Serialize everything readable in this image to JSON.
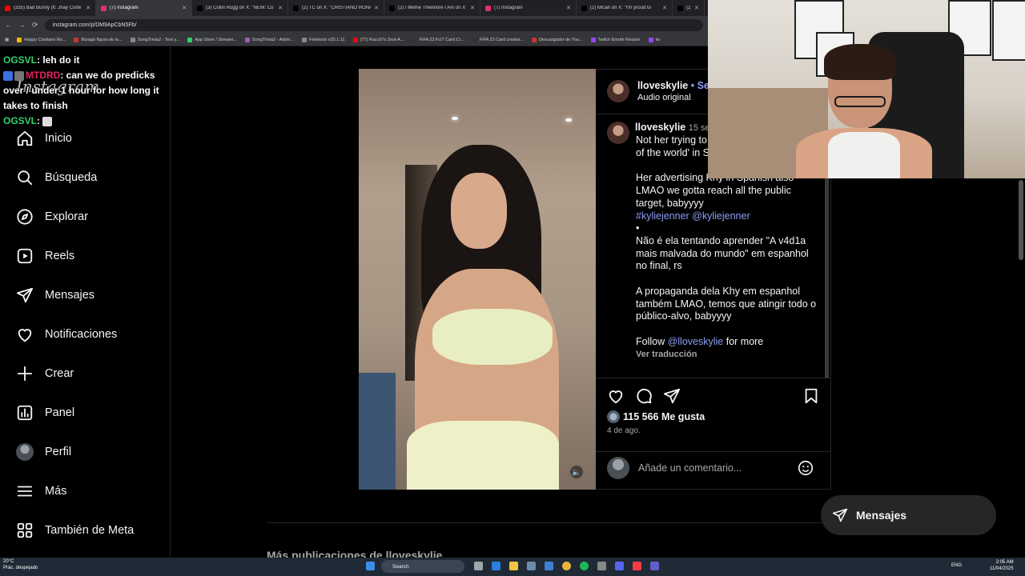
{
  "browser": {
    "tabs": [
      {
        "label": "(335) Bad Bunny (ft. Jhay Corte",
        "color": "#ff0000"
      },
      {
        "label": "(7) Instagram",
        "color": "#e1306c",
        "active": true
      },
      {
        "label": "(3) Collin Rugg on X: \"NEW: Co",
        "color": "#000000"
      },
      {
        "label": "(2) TC on X: \"CRISTIANO RONA",
        "color": "#000000"
      },
      {
        "label": "(2) I Meme Therefore I Am on X",
        "color": "#000000"
      },
      {
        "label": "(7) Instagram",
        "color": "#e1306c"
      },
      {
        "label": "(2) Micah on X: \"I'm proud to",
        "color": "#000000"
      },
      {
        "label": "(2) vie",
        "color": "#000000"
      }
    ],
    "url": "instagram.com/p/DM9ApCbN5Fb/",
    "bookmarks": [
      {
        "label": "Happy Cristiano Ro...",
        "color": "#f4b400"
      },
      {
        "label": "Burago figura de to...",
        "color": "#c0392b"
      },
      {
        "label": "SongTrivia2 - Test y...",
        "color": "#888888"
      },
      {
        "label": "App Store / Streami...",
        "color": "#2ecc71"
      },
      {
        "label": "SongTrivia2 - Advin...",
        "color": "#9b59b6"
      },
      {
        "label": "Feletools v25.1.11",
        "color": "#888888"
      },
      {
        "label": "(77) Racc97s Zest-A...",
        "color": "#ff0000"
      },
      {
        "label": "FIFA 23 FUT Card Cr...",
        "color": "#333333"
      },
      {
        "label": "FIFA 23 Card creator...",
        "color": "#333333"
      },
      {
        "label": "Descargador de You...",
        "color": "#c0392b"
      },
      {
        "label": "Twitch Emote Resizer",
        "color": "#9146ff"
      },
      {
        "label": "tw",
        "color": "#9146ff"
      }
    ]
  },
  "chat": [
    {
      "user": "OGSVL",
      "msg": ": leh do it"
    },
    {
      "user": "MTDRD",
      "msg": ": can we do predicks over / under 1 hour for how long it takes to finish"
    },
    {
      "user": "OGSVL",
      "msg": ": "
    }
  ],
  "sidebar": {
    "logo": "Instagram",
    "items": [
      {
        "label": "Inicio",
        "icon": "home-icon"
      },
      {
        "label": "Búsqueda",
        "icon": "search-icon"
      },
      {
        "label": "Explorar",
        "icon": "compass-icon"
      },
      {
        "label": "Reels",
        "icon": "reels-icon"
      },
      {
        "label": "Mensajes",
        "icon": "send-icon"
      },
      {
        "label": "Notificaciones",
        "icon": "heart-icon"
      },
      {
        "label": "Crear",
        "icon": "plus-icon"
      },
      {
        "label": "Panel",
        "icon": "chart-icon"
      },
      {
        "label": "Perfil",
        "icon": "avatar-icon"
      },
      {
        "label": "Más",
        "icon": "menu-icon"
      },
      {
        "label": "También de Meta",
        "icon": "meta-icon"
      }
    ]
  },
  "post": {
    "header": {
      "username": "lloveskylie",
      "follow": "• Seg",
      "audio": "Audio original"
    },
    "comment": {
      "username": "lloveskylie",
      "time": "15 se",
      "p1": "Not her trying to say 'the baddest b*tch of the world' in Spanish at the end lol 😛",
      "p2a": "Her advertising Khy in Spanish also LMAO we gotta reach all the public target, babyyyy",
      "tags": "#kyliejenner @kyliejenner",
      "bullet": "•",
      "p3": "Não é ela tentando aprender \"A v4d1a mais malvada do mundo\" em espanhol no final, rs",
      "p4": "A propaganda dela Khy em espanhol também LMAO, temos que atingir todo o público-alvo, babyyyy",
      "follow_prefix": "Follow ",
      "follow_handle": "@lloveskylie",
      "follow_suffix": " for more",
      "translate": "Ver traducción"
    },
    "likes": "115 566 Me gusta",
    "date": "4 de ago.",
    "comment_placeholder": "Añade un comentario...",
    "more_from": "Más publicaciones de lloveskylie"
  },
  "messages_button": "Mensajes",
  "taskbar": {
    "temp": "20°C",
    "weather": "Prác. despejado",
    "search": "Search",
    "lang": "ENG",
    "time": "2:05 AM",
    "date": "11/04/2025"
  },
  "colors": {
    "accent_link": "#8c9ef2",
    "ig_bg": "#000000",
    "muted": "#a8a8a8"
  }
}
